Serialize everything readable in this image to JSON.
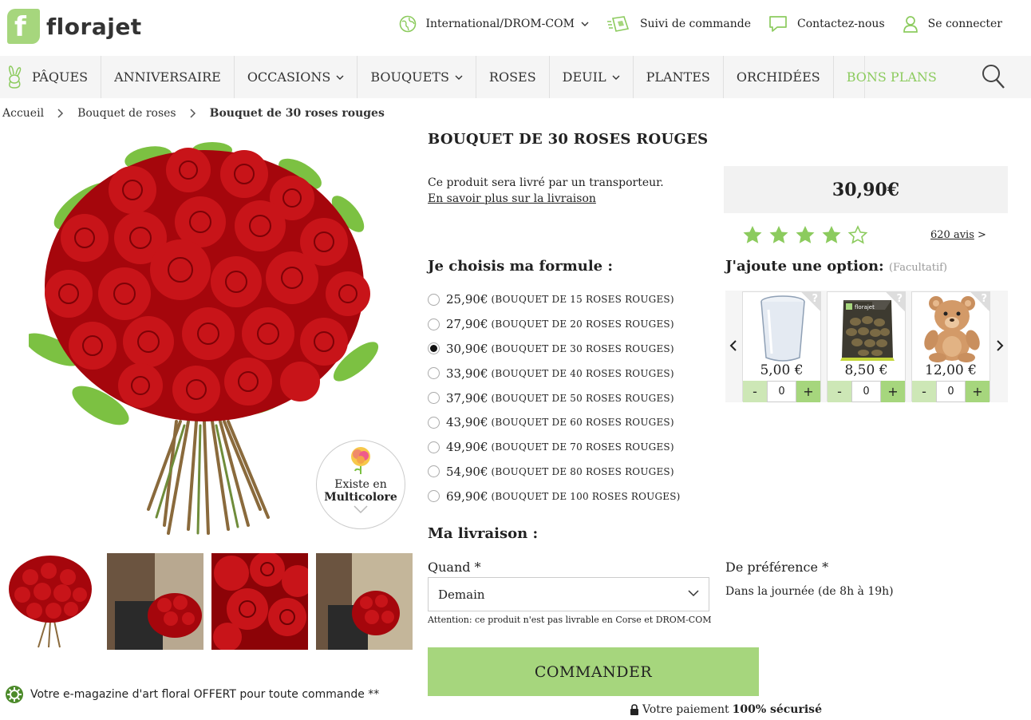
{
  "brand": {
    "name": "florajet",
    "mark": "f",
    "accent": "#a6d67d"
  },
  "topbar": {
    "international": "International/DROM-COM",
    "suivi": "Suivi de commande",
    "contact": "Contactez-nous",
    "login": "Se connecter"
  },
  "nav": {
    "items": [
      "PÂQUES",
      "ANNIVERSAIRE",
      "OCCASIONS",
      "BOUQUETS",
      "ROSES",
      "DEUIL",
      "PLANTES",
      "ORCHIDÉES",
      "BONS PLANS"
    ]
  },
  "breadcrumb": [
    "Accueil",
    "Bouquet de roses",
    "Bouquet de 30 roses rouges"
  ],
  "product": {
    "title": "BOUQUET DE 30 ROSES ROUGES",
    "delivery_text": "Ce produit sera livré par un transporteur.",
    "delivery_link": "En savoir plus sur la livraison",
    "price": "30,90€",
    "rating": 4,
    "rating_max": 5,
    "reviews": "620 avis",
    "reviews_arrow": ">",
    "badge_line1": "Existe en",
    "badge_line2": "Multicolore"
  },
  "formule": {
    "heading": "Je choisis ma formule :",
    "selected_index": 2,
    "options": [
      {
        "price": "25,90€",
        "desc": "(BOUQUET DE 15 ROSES ROUGES)"
      },
      {
        "price": "27,90€",
        "desc": "(BOUQUET DE 20 ROSES ROUGES)"
      },
      {
        "price": "30,90€",
        "desc": "(BOUQUET DE 30 ROSES ROUGES)"
      },
      {
        "price": "33,90€",
        "desc": "(BOUQUET DE 40 ROSES ROUGES)"
      },
      {
        "price": "37,90€",
        "desc": "(BOUQUET DE 50 ROSES ROUGES)"
      },
      {
        "price": "43,90€",
        "desc": "(BOUQUET DE 60 ROSES ROUGES)"
      },
      {
        "price": "49,90€",
        "desc": "(BOUQUET DE 70 ROSES ROUGES)"
      },
      {
        "price": "54,90€",
        "desc": "(BOUQUET DE 80 ROSES ROUGES)"
      },
      {
        "price": "69,90€",
        "desc": "(BOUQUET DE 100 ROSES ROUGES)"
      }
    ]
  },
  "options": {
    "heading": "J'ajoute une option:",
    "optional": "(Facultatif)",
    "help": "?",
    "minus": "-",
    "plus": "+",
    "items": [
      {
        "name": "vase",
        "price": "5,00 €",
        "qty": "0"
      },
      {
        "name": "chocolats",
        "price": "8,50 €",
        "qty": "0",
        "box_label": "florajet"
      },
      {
        "name": "ourson",
        "price": "12,00 €",
        "qty": "0"
      }
    ]
  },
  "livraison": {
    "heading": "Ma livraison :",
    "quand_label": "Quand *",
    "quand_value": "Demain",
    "attention": "Attention: ce produit n'est pas livrable en Corse et DROM-COM",
    "pref_label": "De préférence *",
    "pref_value": "Dans la journée (de 8h à 19h)"
  },
  "cta": {
    "order": "COMMANDER",
    "secure_prefix": "Votre paiement",
    "secure_bold": "100% sécurisé"
  },
  "magazine": "Votre e-magazine d'art floral OFFERT pour toute commande **"
}
